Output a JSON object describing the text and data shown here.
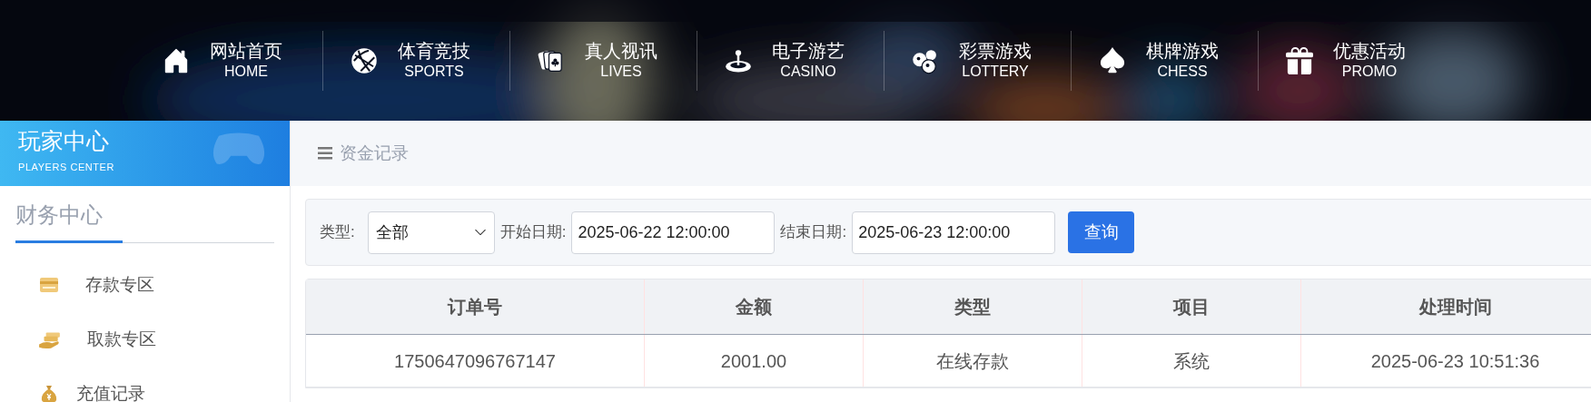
{
  "nav": {
    "items": [
      {
        "label": "网站首页",
        "sublabel": "HOME"
      },
      {
        "label": "体育竞技",
        "sublabel": "SPORTS"
      },
      {
        "label": "真人视讯",
        "sublabel": "LIVES"
      },
      {
        "label": "电子游艺",
        "sublabel": "CASINO"
      },
      {
        "label": "彩票游戏",
        "sublabel": "LOTTERY"
      },
      {
        "label": "棋牌游戏",
        "sublabel": "CHESS"
      },
      {
        "label": "优惠活动",
        "sublabel": "PROMO"
      }
    ]
  },
  "sidebar": {
    "title": "玩家中心",
    "subtitle": "PLAYERS CENTER",
    "section": "财务中心",
    "items": [
      {
        "label": "存款专区"
      },
      {
        "label": "取款专区"
      },
      {
        "label": "充值记录"
      }
    ]
  },
  "breadcrumb": "资金记录",
  "filter": {
    "type_label": "类型:",
    "type_value": "全部",
    "start_label": "开始日期:",
    "start_value": "2025-06-22 12:00:00",
    "end_label": "结束日期:",
    "end_value": "2025-06-23 12:00:00",
    "button": "查询"
  },
  "table": {
    "columns": [
      "订单号",
      "金额",
      "类型",
      "项目",
      "处理时间"
    ],
    "rows": [
      [
        "1750647096767147",
        "2001.00",
        "在线存款",
        "系统",
        "2025-06-23 10:51:36"
      ]
    ]
  }
}
